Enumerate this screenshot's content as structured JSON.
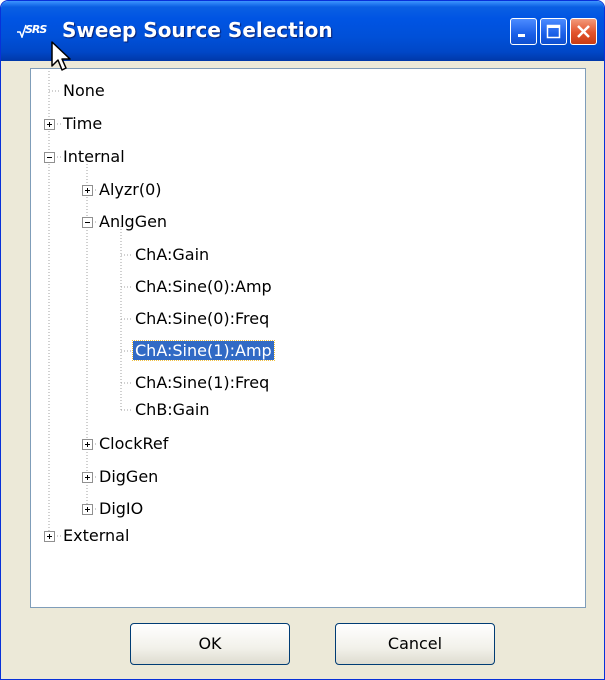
{
  "window": {
    "title": "Sweep Source Selection",
    "app_icon_label": "SRS",
    "colors": {
      "titlebar": "#0054e3",
      "selection": "#316ac5",
      "close_button": "#e2532c"
    }
  },
  "tree": {
    "nodes": [
      {
        "label": "None",
        "expander": "none"
      },
      {
        "label": "Time",
        "expander": "plus"
      },
      {
        "label": "Internal",
        "expander": "minus"
      },
      {
        "label": "Alyzr(0)",
        "expander": "plus"
      },
      {
        "label": "AnlgGen",
        "expander": "minus"
      },
      {
        "label": "ChA:Gain",
        "expander": "none"
      },
      {
        "label": "ChA:Sine(0):Amp",
        "expander": "none"
      },
      {
        "label": "ChA:Sine(0):Freq",
        "expander": "none"
      },
      {
        "label": "ChA:Sine(1):Amp",
        "expander": "none",
        "selected": true
      },
      {
        "label": "ChA:Sine(1):Freq",
        "expander": "none"
      },
      {
        "label": "ChB:Gain",
        "expander": "none"
      },
      {
        "label": "ClockRef",
        "expander": "plus"
      },
      {
        "label": "DigGen",
        "expander": "plus"
      },
      {
        "label": "DigIO",
        "expander": "plus"
      },
      {
        "label": "External",
        "expander": "plus"
      }
    ]
  },
  "buttons": {
    "ok_label": "OK",
    "cancel_label": "Cancel"
  }
}
